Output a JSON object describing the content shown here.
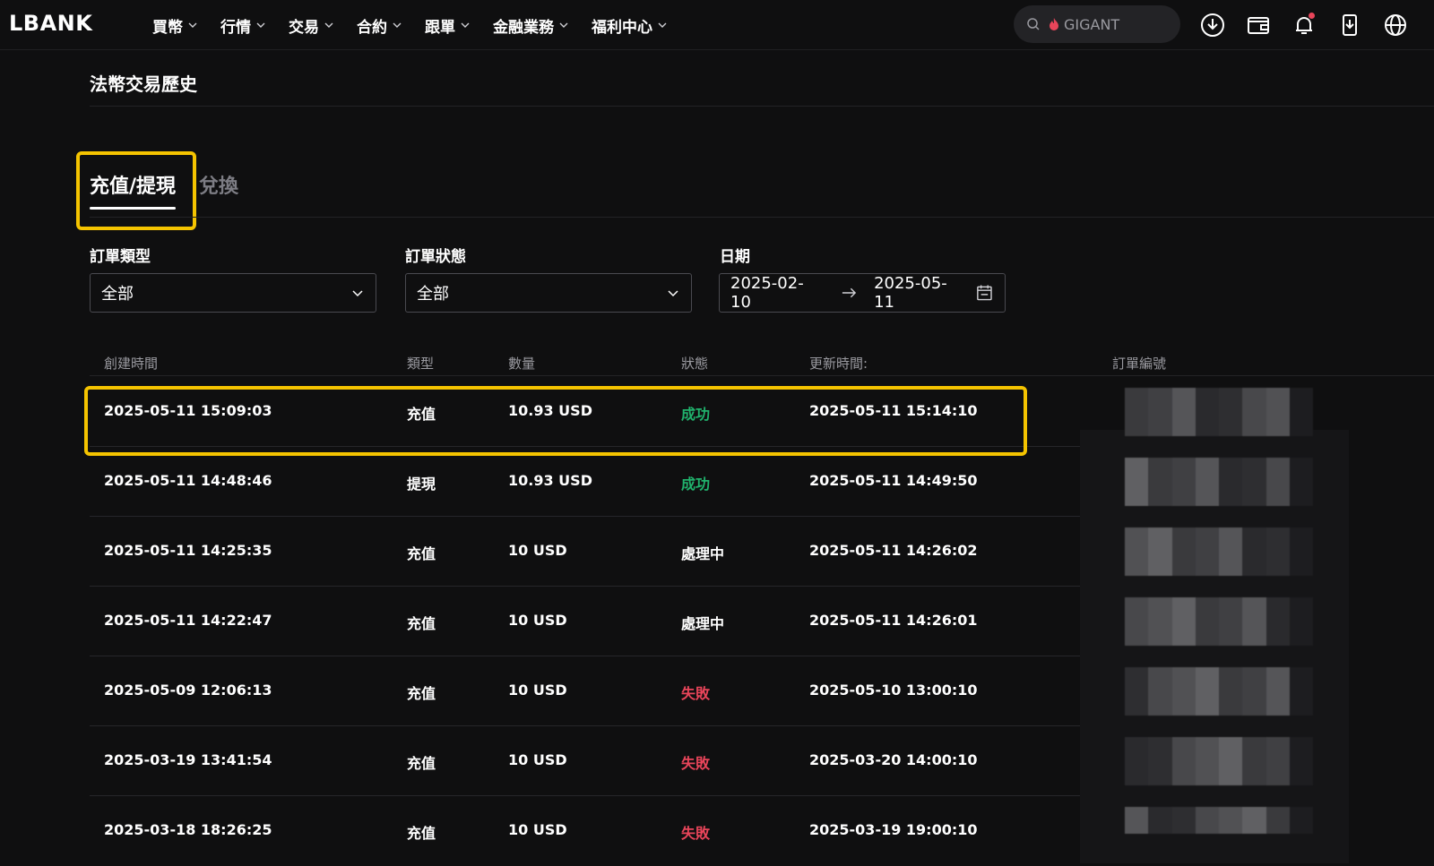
{
  "nav": {
    "logo": "LBANK",
    "menu": [
      {
        "label": "買幣"
      },
      {
        "label": "行情"
      },
      {
        "label": "交易"
      },
      {
        "label": "合約"
      },
      {
        "label": "跟單"
      },
      {
        "label": "金融業務"
      },
      {
        "label": "福利中心"
      }
    ],
    "search_hint": "GIGANT"
  },
  "page": {
    "title": "法幣交易歷史",
    "tabs": [
      {
        "label": "充值/提現",
        "active": true
      },
      {
        "label": "兌換",
        "active": false
      }
    ]
  },
  "filters": {
    "order_type": {
      "label": "訂單類型",
      "value": "全部"
    },
    "order_status": {
      "label": "訂單狀態",
      "value": "全部"
    },
    "date": {
      "label": "日期",
      "start": "2025-02-10",
      "end": "2025-05-11"
    }
  },
  "table": {
    "headers": {
      "created": "創建時間",
      "type": "類型",
      "amount": "數量",
      "status": "狀態",
      "updated": "更新時間:",
      "order_id": "訂單編號"
    },
    "rows": [
      {
        "created": "2025-05-11 15:09:03",
        "type": "充值",
        "amount": "10.93 USD",
        "status": "成功",
        "status_kind": "success",
        "updated": "2025-05-11 15:14:10"
      },
      {
        "created": "2025-05-11 14:48:46",
        "type": "提現",
        "amount": "10.93 USD",
        "status": "成功",
        "status_kind": "success",
        "updated": "2025-05-11 14:49:50"
      },
      {
        "created": "2025-05-11 14:25:35",
        "type": "充值",
        "amount": "10 USD",
        "status": "處理中",
        "status_kind": "processing",
        "updated": "2025-05-11 14:26:02"
      },
      {
        "created": "2025-05-11 14:22:47",
        "type": "充值",
        "amount": "10 USD",
        "status": "處理中",
        "status_kind": "processing",
        "updated": "2025-05-11 14:26:01"
      },
      {
        "created": "2025-05-09 12:06:13",
        "type": "充值",
        "amount": "10 USD",
        "status": "失敗",
        "status_kind": "fail",
        "updated": "2025-05-10 13:00:10"
      },
      {
        "created": "2025-03-19 13:41:54",
        "type": "充值",
        "amount": "10 USD",
        "status": "失敗",
        "status_kind": "fail",
        "updated": "2025-03-20 14:00:10"
      },
      {
        "created": "2025-03-18 18:26:25",
        "type": "充值",
        "amount": "10 USD",
        "status": "失敗",
        "status_kind": "fail",
        "updated": "2025-03-19 19:00:10"
      }
    ]
  },
  "colors": {
    "background": "#0f0f10",
    "highlight": "#f5c400",
    "success": "#20b26c",
    "fail": "#e8455a",
    "notification_dot": "#e8455a",
    "search_flame": "#e8455a"
  },
  "icons": [
    "search-icon",
    "flame-icon",
    "download-icon",
    "wallet-icon",
    "bell-icon",
    "app-download-icon",
    "globe-icon",
    "chevron-down-icon",
    "arrow-right-icon",
    "calendar-icon"
  ]
}
